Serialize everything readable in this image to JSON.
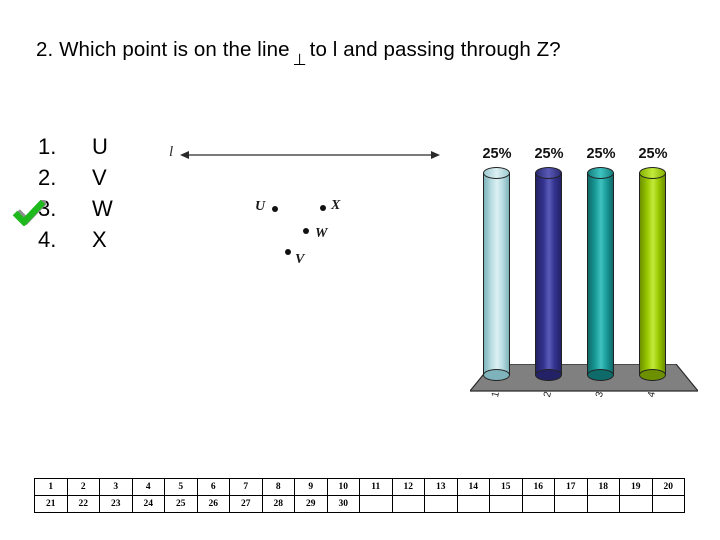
{
  "slide": {
    "question": {
      "prefix": "2.  Which point is on the line",
      "perp_symbol": "⊥",
      "suffix": "to l and passing through Z?"
    },
    "choices": [
      {
        "num": "1.",
        "text": "U",
        "correct": false
      },
      {
        "num": "2.",
        "text": "V",
        "correct": false
      },
      {
        "num": "3.",
        "text": "W",
        "correct": true
      },
      {
        "num": "4.",
        "text": "X",
        "correct": false
      }
    ],
    "figure": {
      "line_label": "l",
      "points": [
        {
          "name": "U",
          "label_side": "left",
          "x": 107,
          "y": 70
        },
        {
          "name": "X",
          "label_side": "right",
          "x": 155,
          "y": 69
        },
        {
          "name": "W",
          "label_side": "right",
          "x": 138,
          "y": 92
        },
        {
          "name": "V",
          "label_side": "below",
          "x": 120,
          "y": 113
        }
      ]
    },
    "chart_data": {
      "type": "bar",
      "title": "",
      "xlabel": "",
      "ylabel": "",
      "categories": [
        "1",
        "2",
        "3",
        "4"
      ],
      "values": [
        25,
        25,
        25,
        25
      ],
      "value_labels": [
        "25%",
        "25%",
        "25%",
        "25%"
      ],
      "ylim": [
        0,
        100
      ],
      "grid": false,
      "legend": "none",
      "colors": [
        "#b9dde2",
        "#33338f",
        "#199a99",
        "#9ac901"
      ],
      "colors_dark": [
        "#7fb3bb",
        "#232266",
        "#0f6b6a",
        "#6d9000"
      ],
      "colors_light": [
        "#dcf0f3",
        "#5a5ab8",
        "#3fc3c0",
        "#c2ea3c"
      ],
      "floor_color": "#808080",
      "floor_edge": "#2b2b2b"
    },
    "number_grid": {
      "rows": [
        [
          "1",
          "2",
          "3",
          "4",
          "5",
          "6",
          "7",
          "8",
          "9",
          "10",
          "11",
          "12",
          "13",
          "14",
          "15",
          "16",
          "17",
          "18",
          "19",
          "20"
        ],
        [
          "21",
          "22",
          "23",
          "24",
          "25",
          "26",
          "27",
          "28",
          "29",
          "30",
          "",
          "",
          "",
          "",
          "",
          "",
          "",
          "",
          "",
          ""
        ]
      ]
    },
    "colors": {
      "check_green": "#1db91d",
      "check_shadow": "#8e8e8e",
      "text": "#000000"
    }
  }
}
